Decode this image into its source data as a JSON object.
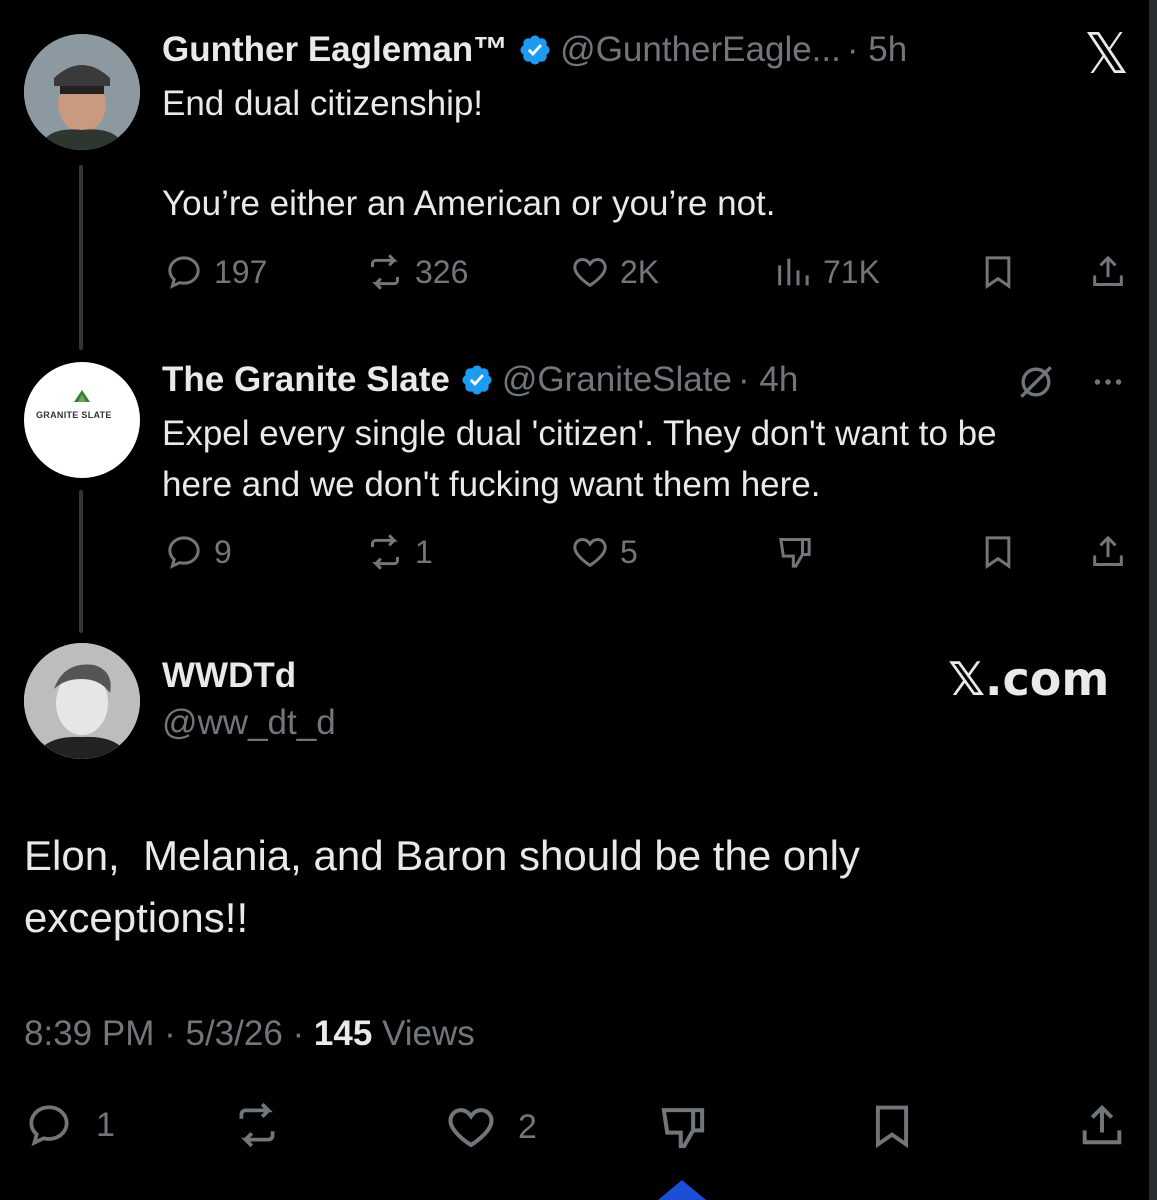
{
  "x_logo_top": "𝕏",
  "tweets": [
    {
      "name": "Gunther Eagleman™",
      "handle": "@GuntherEagle...",
      "time": "· 5h",
      "text_line1": "End dual citizenship!",
      "text_line2": "You’re either an American or you’re not.",
      "replies": "197",
      "reposts": "326",
      "likes": "2K",
      "views": "71K"
    },
    {
      "name": "The Granite Slate",
      "handle": "@GraniteSlate",
      "time": "· 4h",
      "avatar_text": "GRANITE SLATE",
      "text_line1": "Expel every single dual 'citizen'. They don't want to be",
      "text_line2": "here and we don't fucking want them here.",
      "replies": "9",
      "reposts": "1",
      "likes": "5"
    }
  ],
  "main": {
    "name": "WWDTd",
    "handle": "@ww_dt_d",
    "brand": "𝕏.com",
    "text_line1": "Elon,  Melania, and Baron should be the only",
    "text_line2": "exceptions!!",
    "time": "8:39 PM",
    "date": "5/3/26",
    "views_count": "145",
    "views_label": "Views",
    "replies": "1",
    "likes": "2",
    "sep": "·"
  },
  "colors": {
    "background": "#000000",
    "text": "#e7e9ea",
    "muted": "#71767b",
    "verified": "#1d9bf0",
    "accent": "#1d4ed8"
  }
}
